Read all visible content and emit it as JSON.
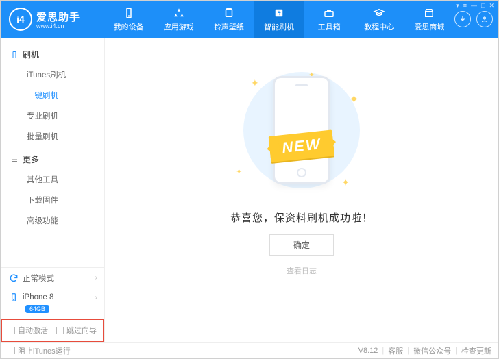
{
  "app": {
    "name": "爱思助手",
    "url": "www.i4.cn",
    "logo_text": "i4"
  },
  "window_controls": [
    "▾",
    "≡",
    "—",
    "□",
    "✕"
  ],
  "nav": [
    {
      "label": "我的设备",
      "icon": "device"
    },
    {
      "label": "应用游戏",
      "icon": "apps"
    },
    {
      "label": "铃声壁纸",
      "icon": "music"
    },
    {
      "label": "智能刷机",
      "icon": "flash",
      "active": true
    },
    {
      "label": "工具箱",
      "icon": "toolbox"
    },
    {
      "label": "教程中心",
      "icon": "edu"
    },
    {
      "label": "爱思商城",
      "icon": "shop"
    }
  ],
  "sidebar": {
    "sections": [
      {
        "title": "刷机",
        "icon": "flash-sm",
        "items": [
          "iTunes刷机",
          "一键刷机",
          "专业刷机",
          "批量刷机"
        ],
        "active_index": 1
      },
      {
        "title": "更多",
        "icon": "more",
        "items": [
          "其他工具",
          "下载固件",
          "高级功能"
        ]
      }
    ],
    "mode": {
      "label": "正常模式",
      "icon": "refresh"
    },
    "device": {
      "name": "iPhone 8",
      "storage": "64GB",
      "icon": "phone"
    },
    "bottom_options": [
      {
        "label": "自动激活",
        "checked": false
      },
      {
        "label": "跳过向导",
        "checked": false
      }
    ]
  },
  "main": {
    "ribbon": "NEW",
    "success_text": "恭喜您，保资料刷机成功啦！",
    "ok_button": "确定",
    "log_link": "查看日志"
  },
  "footer": {
    "block_itunes": "阻止iTunes运行",
    "version": "V8.12",
    "links": [
      "客服",
      "微信公众号",
      "检查更新"
    ]
  }
}
